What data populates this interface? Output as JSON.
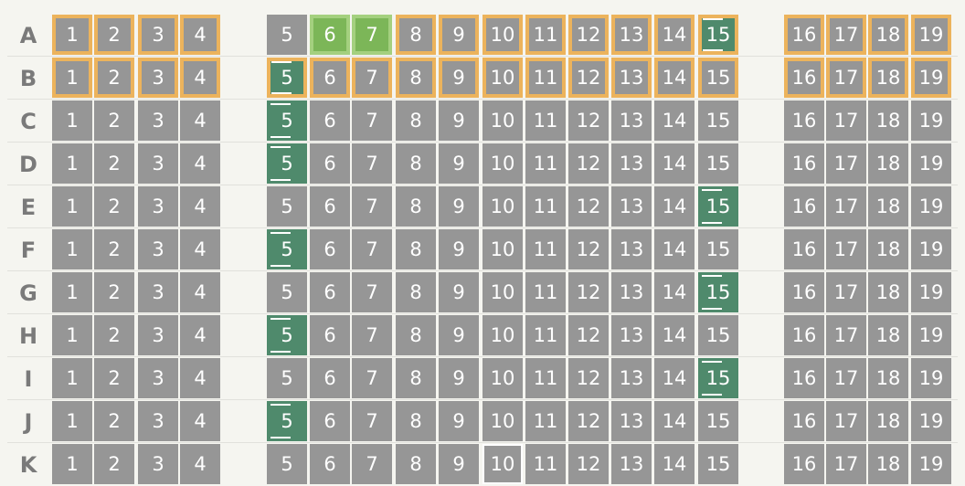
{
  "seat_map": {
    "colors": {
      "seat": "#969696",
      "premium_border": "#ecb35c",
      "selected": "#7cb658",
      "exit_row": "#4f8a6c",
      "label": "#7a7a7a"
    },
    "rows": [
      {
        "label": "A",
        "seats": [
          {
            "number": "1",
            "class": "premium"
          },
          {
            "number": "2",
            "class": "premium"
          },
          {
            "number": "3",
            "class": "premium"
          },
          {
            "number": "4",
            "class": "premium"
          },
          {
            "number": "5",
            "class": "standard"
          },
          {
            "number": "6",
            "class": "premium",
            "status": "selected"
          },
          {
            "number": "7",
            "class": "premium",
            "status": "selected"
          },
          {
            "number": "8",
            "class": "premium"
          },
          {
            "number": "9",
            "class": "premium"
          },
          {
            "number": "10",
            "class": "premium"
          },
          {
            "number": "11",
            "class": "premium"
          },
          {
            "number": "12",
            "class": "premium"
          },
          {
            "number": "13",
            "class": "premium"
          },
          {
            "number": "14",
            "class": "premium"
          },
          {
            "number": "15",
            "class": "premium",
            "status": "exit"
          },
          {
            "number": "16",
            "class": "premium"
          },
          {
            "number": "17",
            "class": "premium"
          },
          {
            "number": "18",
            "class": "premium"
          },
          {
            "number": "19",
            "class": "premium"
          }
        ]
      },
      {
        "label": "B",
        "seats": [
          {
            "number": "1",
            "class": "premium"
          },
          {
            "number": "2",
            "class": "premium"
          },
          {
            "number": "3",
            "class": "premium"
          },
          {
            "number": "4",
            "class": "premium"
          },
          {
            "number": "5",
            "class": "premium",
            "status": "exit"
          },
          {
            "number": "6",
            "class": "premium"
          },
          {
            "number": "7",
            "class": "premium"
          },
          {
            "number": "8",
            "class": "premium"
          },
          {
            "number": "9",
            "class": "premium"
          },
          {
            "number": "10",
            "class": "premium"
          },
          {
            "number": "11",
            "class": "premium"
          },
          {
            "number": "12",
            "class": "premium"
          },
          {
            "number": "13",
            "class": "premium"
          },
          {
            "number": "14",
            "class": "premium"
          },
          {
            "number": "15",
            "class": "premium"
          },
          {
            "number": "16",
            "class": "premium"
          },
          {
            "number": "17",
            "class": "premium"
          },
          {
            "number": "18",
            "class": "premium"
          },
          {
            "number": "19",
            "class": "premium"
          }
        ]
      },
      {
        "label": "C",
        "seats": [
          {
            "number": "1"
          },
          {
            "number": "2"
          },
          {
            "number": "3"
          },
          {
            "number": "4"
          },
          {
            "number": "5",
            "status": "exit"
          },
          {
            "number": "6"
          },
          {
            "number": "7"
          },
          {
            "number": "8"
          },
          {
            "number": "9"
          },
          {
            "number": "10"
          },
          {
            "number": "11"
          },
          {
            "number": "12"
          },
          {
            "number": "13"
          },
          {
            "number": "14"
          },
          {
            "number": "15"
          },
          {
            "number": "16"
          },
          {
            "number": "17"
          },
          {
            "number": "18"
          },
          {
            "number": "19"
          }
        ]
      },
      {
        "label": "D",
        "seats": [
          {
            "number": "1"
          },
          {
            "number": "2"
          },
          {
            "number": "3"
          },
          {
            "number": "4"
          },
          {
            "number": "5",
            "status": "exit"
          },
          {
            "number": "6"
          },
          {
            "number": "7"
          },
          {
            "number": "8"
          },
          {
            "number": "9"
          },
          {
            "number": "10"
          },
          {
            "number": "11"
          },
          {
            "number": "12"
          },
          {
            "number": "13"
          },
          {
            "number": "14"
          },
          {
            "number": "15"
          },
          {
            "number": "16"
          },
          {
            "number": "17"
          },
          {
            "number": "18"
          },
          {
            "number": "19"
          }
        ]
      },
      {
        "label": "E",
        "seats": [
          {
            "number": "1"
          },
          {
            "number": "2"
          },
          {
            "number": "3"
          },
          {
            "number": "4"
          },
          {
            "number": "5"
          },
          {
            "number": "6"
          },
          {
            "number": "7"
          },
          {
            "number": "8"
          },
          {
            "number": "9"
          },
          {
            "number": "10"
          },
          {
            "number": "11"
          },
          {
            "number": "12"
          },
          {
            "number": "13"
          },
          {
            "number": "14"
          },
          {
            "number": "15",
            "status": "exit"
          },
          {
            "number": "16"
          },
          {
            "number": "17"
          },
          {
            "number": "18"
          },
          {
            "number": "19"
          }
        ]
      },
      {
        "label": "F",
        "seats": [
          {
            "number": "1"
          },
          {
            "number": "2"
          },
          {
            "number": "3"
          },
          {
            "number": "4"
          },
          {
            "number": "5",
            "status": "exit"
          },
          {
            "number": "6"
          },
          {
            "number": "7"
          },
          {
            "number": "8"
          },
          {
            "number": "9"
          },
          {
            "number": "10"
          },
          {
            "number": "11"
          },
          {
            "number": "12"
          },
          {
            "number": "13"
          },
          {
            "number": "14"
          },
          {
            "number": "15"
          },
          {
            "number": "16"
          },
          {
            "number": "17"
          },
          {
            "number": "18"
          },
          {
            "number": "19"
          }
        ]
      },
      {
        "label": "G",
        "seats": [
          {
            "number": "1"
          },
          {
            "number": "2"
          },
          {
            "number": "3"
          },
          {
            "number": "4"
          },
          {
            "number": "5"
          },
          {
            "number": "6"
          },
          {
            "number": "7"
          },
          {
            "number": "8"
          },
          {
            "number": "9"
          },
          {
            "number": "10"
          },
          {
            "number": "11"
          },
          {
            "number": "12"
          },
          {
            "number": "13"
          },
          {
            "number": "14"
          },
          {
            "number": "15",
            "status": "exit"
          },
          {
            "number": "16"
          },
          {
            "number": "17"
          },
          {
            "number": "18"
          },
          {
            "number": "19"
          }
        ]
      },
      {
        "label": "H",
        "seats": [
          {
            "number": "1"
          },
          {
            "number": "2"
          },
          {
            "number": "3"
          },
          {
            "number": "4"
          },
          {
            "number": "5",
            "status": "exit"
          },
          {
            "number": "6"
          },
          {
            "number": "7"
          },
          {
            "number": "8"
          },
          {
            "number": "9"
          },
          {
            "number": "10"
          },
          {
            "number": "11"
          },
          {
            "number": "12"
          },
          {
            "number": "13"
          },
          {
            "number": "14"
          },
          {
            "number": "15"
          },
          {
            "number": "16"
          },
          {
            "number": "17"
          },
          {
            "number": "18"
          },
          {
            "number": "19"
          }
        ]
      },
      {
        "label": "I",
        "seats": [
          {
            "number": "1"
          },
          {
            "number": "2"
          },
          {
            "number": "3"
          },
          {
            "number": "4"
          },
          {
            "number": "5"
          },
          {
            "number": "6"
          },
          {
            "number": "7"
          },
          {
            "number": "8"
          },
          {
            "number": "9"
          },
          {
            "number": "10"
          },
          {
            "number": "11"
          },
          {
            "number": "12"
          },
          {
            "number": "13"
          },
          {
            "number": "14"
          },
          {
            "number": "15",
            "status": "exit"
          },
          {
            "number": "16"
          },
          {
            "number": "17"
          },
          {
            "number": "18"
          },
          {
            "number": "19"
          }
        ]
      },
      {
        "label": "J",
        "seats": [
          {
            "number": "1"
          },
          {
            "number": "2"
          },
          {
            "number": "3"
          },
          {
            "number": "4"
          },
          {
            "number": "5",
            "status": "exit"
          },
          {
            "number": "6"
          },
          {
            "number": "7"
          },
          {
            "number": "8"
          },
          {
            "number": "9"
          },
          {
            "number": "10"
          },
          {
            "number": "11"
          },
          {
            "number": "12"
          },
          {
            "number": "13"
          },
          {
            "number": "14"
          },
          {
            "number": "15"
          },
          {
            "number": "16"
          },
          {
            "number": "17"
          },
          {
            "number": "18"
          },
          {
            "number": "19"
          }
        ]
      },
      {
        "label": "K",
        "seats": [
          {
            "number": "1"
          },
          {
            "number": "2"
          },
          {
            "number": "3"
          },
          {
            "number": "4"
          },
          {
            "number": "5"
          },
          {
            "number": "6"
          },
          {
            "number": "7"
          },
          {
            "number": "8"
          },
          {
            "number": "9"
          },
          {
            "number": "10",
            "status": "outlined"
          },
          {
            "number": "11"
          },
          {
            "number": "12"
          },
          {
            "number": "13"
          },
          {
            "number": "14"
          },
          {
            "number": "15"
          },
          {
            "number": "16"
          },
          {
            "number": "17"
          },
          {
            "number": "18"
          },
          {
            "number": "19"
          }
        ]
      }
    ]
  }
}
